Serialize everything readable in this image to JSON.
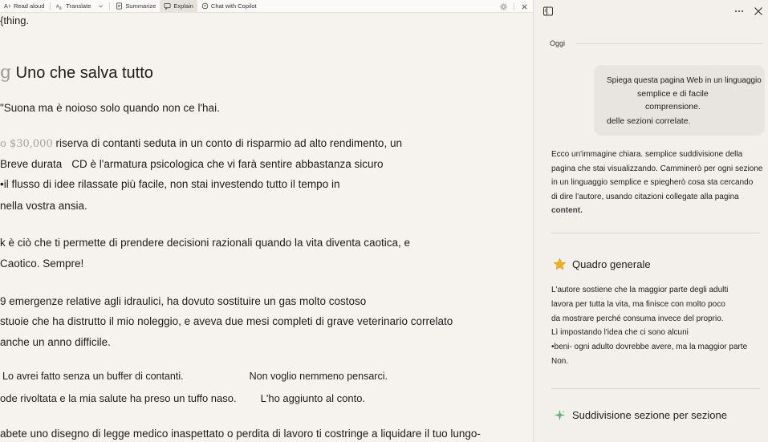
{
  "toolbar": {
    "read_aloud": "Read aloud",
    "translate": "Translate",
    "summarize": "Summarize",
    "explain": "Explain",
    "chat": "Chat with Copilot"
  },
  "reader": {
    "fragment_top": "{thing.",
    "heading_prefix": "g",
    "heading": "Uno che salva tutto",
    "p1": "\"Suona ma è noioso solo quando non ce l'hai.",
    "p2_money": "o $30,000",
    "p2_rest": " riserva di contanti seduta in un conto di risparmio ad alto rendimento, un",
    "p2_line2a": "Breve durata",
    "p2_line2b": "CD è l'armatura psicologica che vi farà sentire abbastanza sicuro",
    "p2_line3": "•il flusso di idee rilassate più facile, non stai investendo tutto il tempo in",
    "p2_line4": "nella vostra ansia.",
    "p3_line1": "k è ciò che ti permette di prendere decisioni razionali quando la vita diventa caotica, e",
    "p3_line2": "Caotico. Sempre!",
    "p4_line1": "9 emergenze relative agli idraulici, ha dovuto sostituire un gas molto costoso",
    "p4_line2": "stuoie che ha distrutto il mio noleggio, e aveva due mesi completi di grave veterinario correlato",
    "p4_line3": "anche un anno difficile.",
    "p5_line1a": "Lo avrei fatto senza un buffer di contanti.",
    "p5_line1b": "Non voglio nemmeno pensarci.",
    "p5_line2a": "ode rivoltata e la mia salute ha preso un tuffo naso.",
    "p5_line2b": "L'ho aggiunto al conto.",
    "p6_line1": "abete uno disegno di legge medico inaspettato o perdita di lavoro ti costringe a liquidare il tuo lungo-"
  },
  "side": {
    "date_label": "Oggi",
    "user_message": {
      "line1": "Spiega questa pagina Web in un linguaggio",
      "line2": "semplice e di facile",
      "line3": "comprensione.",
      "line4": "delle sezioni correlate."
    },
    "reply": {
      "line1": "Ecco un'immagine chiara. semplice suddivisione della",
      "line2": "pagina che stai visualizzando. Camminerò per ogni sezione",
      "line3": "in un linguaggio semplice e spiegherò cosa sta cercando",
      "line4": "di dire l'autore, usando citazioni collegate alla pagina",
      "line5": "content."
    },
    "overview_title": "Quadro generale",
    "overview": {
      "line1": "L'autore sostiene che la maggior parte degli adulti",
      "line2": "lavora per tutta la vita, ma finisce con molto poco",
      "line3": "da mostrare perché consuma invece del proprio.",
      "line4": "Lì impostando l'idea che ci sono alcuni",
      "line5": "•beni- ogni adulto dovrebbe avere, ma la maggior parte",
      "line6": "Non."
    },
    "breakdown_title": "Suddivisione sezione per sezione"
  },
  "colors": {
    "reader_bg": "#f6f3ee",
    "side_bg": "#f3f0ec",
    "bubble_bg": "#e8e5e0",
    "star": "#f2b01e",
    "sparkle": "#5fb07a"
  }
}
